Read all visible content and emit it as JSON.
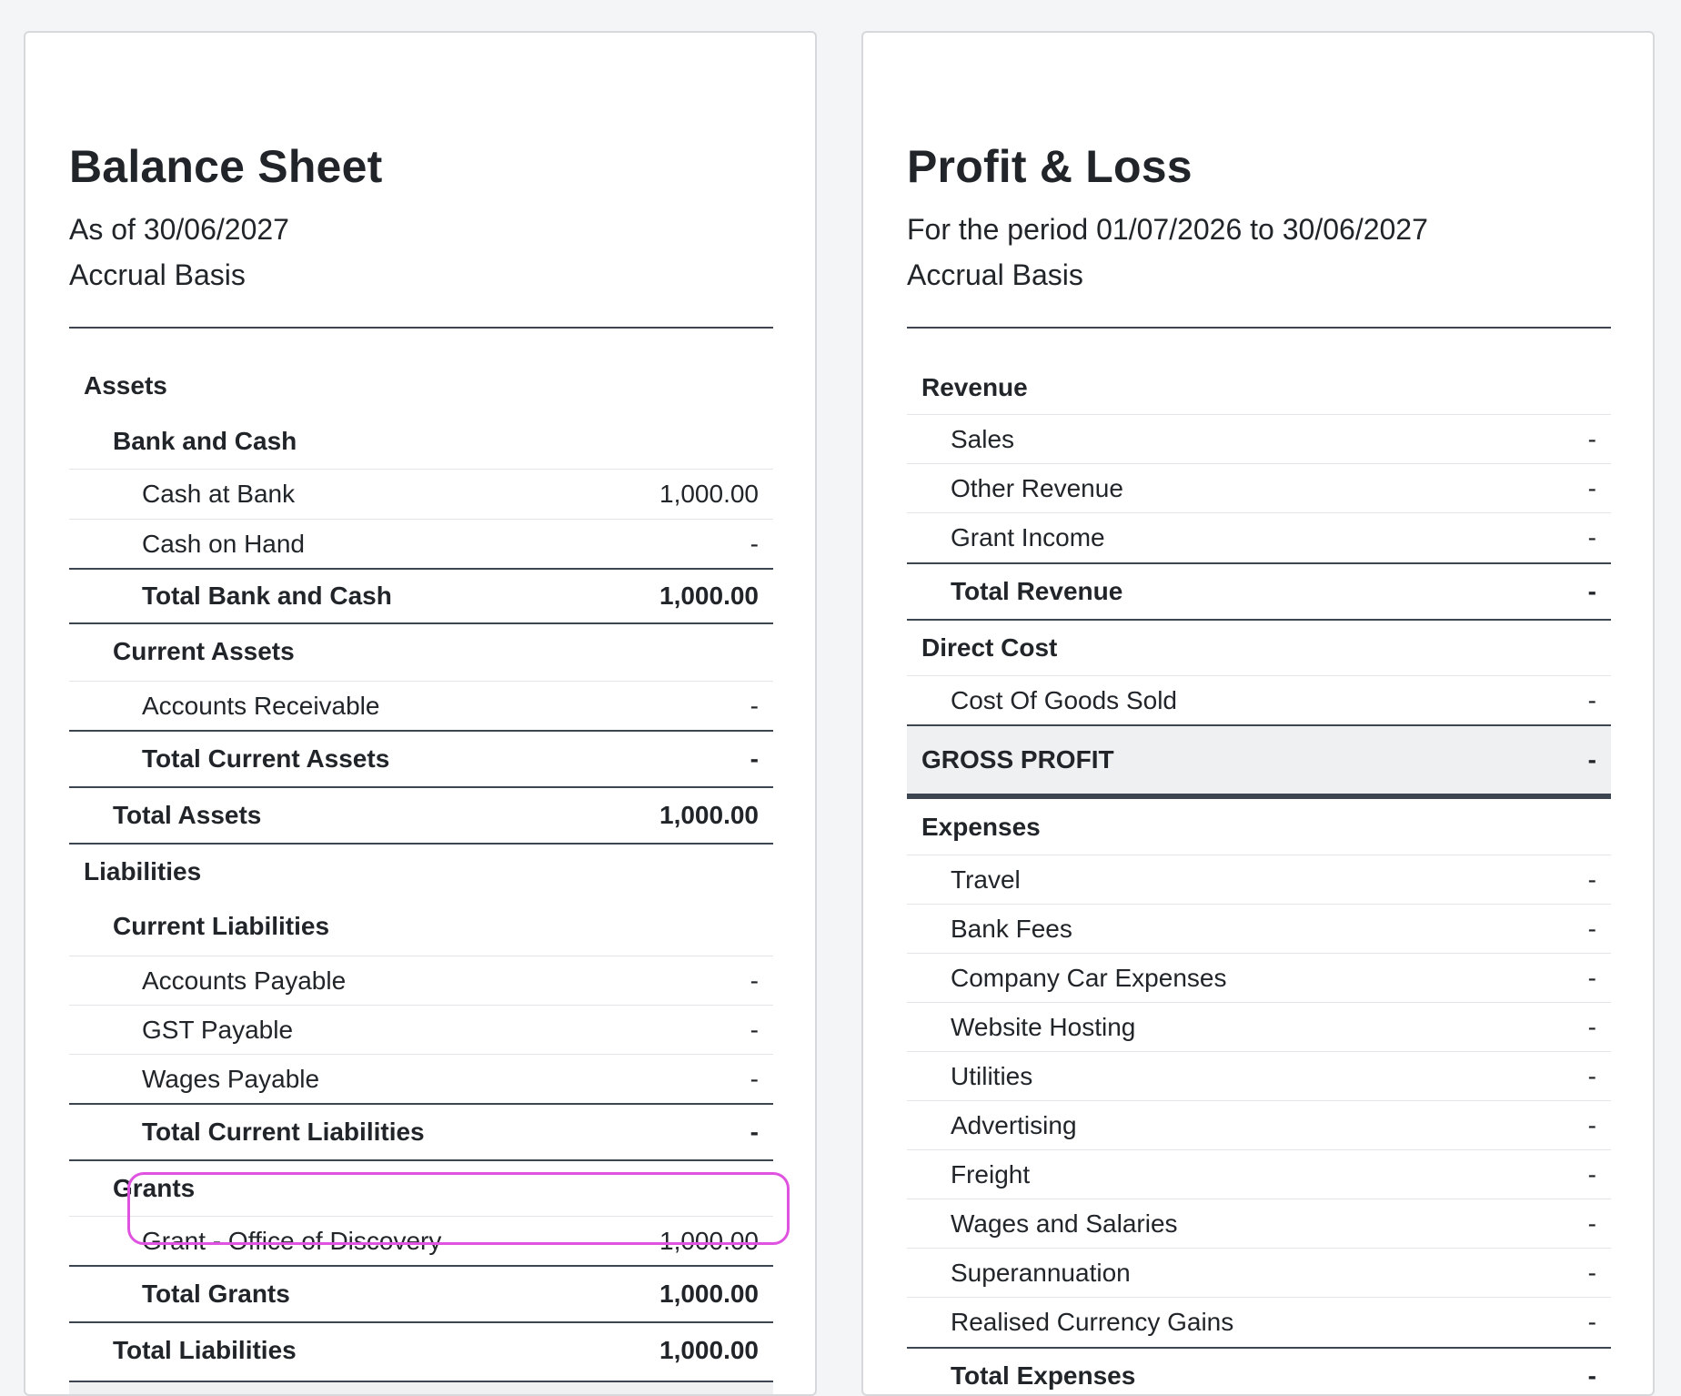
{
  "balance_sheet": {
    "title": "Balance Sheet",
    "date_line": "As of 30/06/2027",
    "basis": "Accrual Basis",
    "rows": {
      "assets": "Assets",
      "bank_and_cash": "Bank and Cash",
      "cash_at_bank": {
        "label": "Cash at Bank",
        "value": "1,000.00"
      },
      "cash_on_hand": {
        "label": "Cash on Hand",
        "value": "-"
      },
      "total_bank_and_cash": {
        "label": "Total Bank and Cash",
        "value": "1,000.00"
      },
      "current_assets": "Current Assets",
      "accounts_receivable": {
        "label": "Accounts Receivable",
        "value": "-"
      },
      "total_current_assets": {
        "label": "Total Current Assets",
        "value": "-"
      },
      "total_assets": {
        "label": "Total Assets",
        "value": "1,000.00"
      },
      "liabilities": "Liabilities",
      "current_liabilities": "Current Liabilities",
      "accounts_payable": {
        "label": "Accounts Payable",
        "value": "-"
      },
      "gst_payable": {
        "label": "GST Payable",
        "value": "-"
      },
      "wages_payable": {
        "label": "Wages Payable",
        "value": "-"
      },
      "total_current_liabilities": {
        "label": "Total Current Liabilities",
        "value": "-"
      },
      "grants": "Grants",
      "grant_office_of_discovery": {
        "label": "Grant - Office of Discovery",
        "value": "1,000.00"
      },
      "total_grants": {
        "label": "Total Grants",
        "value": "1,000.00"
      },
      "total_liabilities": {
        "label": "Total Liabilities",
        "value": "1,000.00"
      }
    }
  },
  "profit_loss": {
    "title": "Profit & Loss",
    "period_line": "For the period 01/07/2026 to 30/06/2027",
    "basis": "Accrual Basis",
    "rows": {
      "revenue": "Revenue",
      "sales": {
        "label": "Sales",
        "value": "-"
      },
      "other_revenue": {
        "label": "Other Revenue",
        "value": "-"
      },
      "grant_income": {
        "label": "Grant Income",
        "value": "-"
      },
      "total_revenue": {
        "label": "Total Revenue",
        "value": "-"
      },
      "direct_cost": "Direct Cost",
      "cost_of_goods_sold": {
        "label": "Cost Of Goods Sold",
        "value": "-"
      },
      "gross_profit": {
        "label": "GROSS PROFIT",
        "value": "-"
      },
      "expenses": "Expenses",
      "travel": {
        "label": "Travel",
        "value": "-"
      },
      "bank_fees": {
        "label": "Bank Fees",
        "value": "-"
      },
      "company_car_expenses": {
        "label": "Company Car Expenses",
        "value": "-"
      },
      "website_hosting": {
        "label": "Website Hosting",
        "value": "-"
      },
      "utilities": {
        "label": "Utilities",
        "value": "-"
      },
      "advertising": {
        "label": "Advertising",
        "value": "-"
      },
      "freight": {
        "label": "Freight",
        "value": "-"
      },
      "wages_and_salaries": {
        "label": "Wages and Salaries",
        "value": "-"
      },
      "superannuation": {
        "label": "Superannuation",
        "value": "-"
      },
      "realised_currency_gains": {
        "label": "Realised Currency Gains",
        "value": "-"
      },
      "total_expenses": {
        "label": "Total Expenses",
        "value": "-"
      }
    }
  },
  "colors": {
    "highlight_outline": "#e052e0",
    "rule_dark": "#3d4650",
    "gross_profit_bg": "#eef0f2"
  }
}
